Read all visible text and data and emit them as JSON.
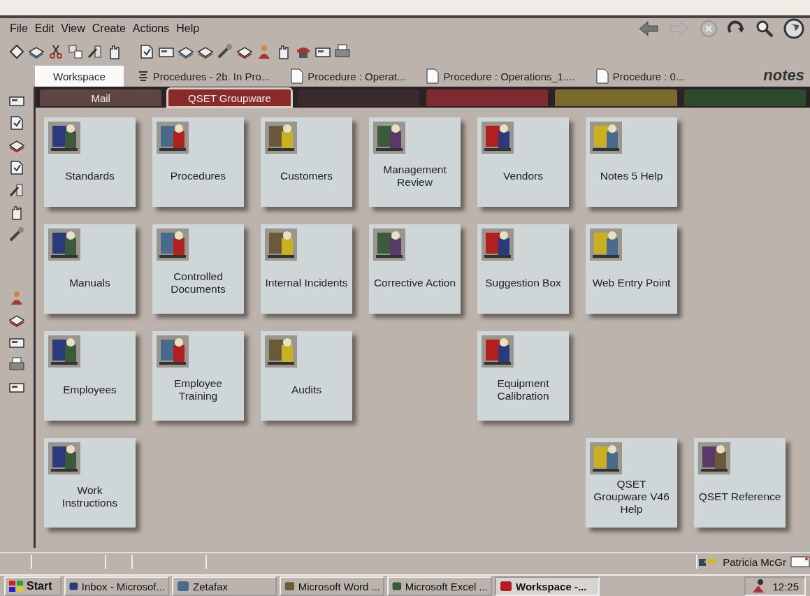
{
  "menu": [
    "File",
    "Edit",
    "View",
    "Create",
    "Actions",
    "Help"
  ],
  "window_tabs": [
    {
      "label": "Workspace",
      "selected": true,
      "kind": "plain"
    },
    {
      "label": "Procedures - 2b. In Pro...",
      "selected": false,
      "kind": "view"
    },
    {
      "label": "Procedure : Operat...",
      "selected": false,
      "kind": "doc"
    },
    {
      "label": "Procedure : Operations_1....",
      "selected": false,
      "kind": "doc"
    },
    {
      "label": "Procedure : 0...",
      "selected": false,
      "kind": "doc"
    }
  ],
  "logo": "notes",
  "workspace_tabs": [
    {
      "label": "Mail",
      "selected": false,
      "color": "#5e4642"
    },
    {
      "label": "QSET Groupware",
      "selected": true,
      "color": "#8a2a2a"
    },
    {
      "selected": false,
      "color": "#3a2a2e"
    },
    {
      "selected": false,
      "color": "#7e2a30"
    },
    {
      "selected": false,
      "color": "#7a6a2e"
    },
    {
      "selected": false,
      "color": "#2e4a2e"
    }
  ],
  "tile_rows": [
    [
      {
        "kind": "tile",
        "label": "Standards"
      },
      {
        "kind": "tile",
        "label": "Procedures"
      },
      {
        "kind": "tile",
        "label": "Customers"
      },
      {
        "kind": "tile",
        "label": "Management Review"
      },
      {
        "kind": "tile",
        "label": "Vendors"
      },
      {
        "kind": "tile",
        "label": "Notes 5 Help"
      },
      {
        "kind": "empty"
      }
    ],
    [
      {
        "kind": "tile",
        "label": "Manuals"
      },
      {
        "kind": "tile",
        "label": "Controlled Documents"
      },
      {
        "kind": "tile",
        "label": "Internal Incidents"
      },
      {
        "kind": "tile",
        "label": "Corrective Action"
      },
      {
        "kind": "tile",
        "label": "Suggestion Box"
      },
      {
        "kind": "tile",
        "label": "Web Entry Point"
      },
      {
        "kind": "empty"
      }
    ],
    [
      {
        "kind": "tile",
        "label": "Employees"
      },
      {
        "kind": "tile",
        "label": "Employee Training"
      },
      {
        "kind": "tile",
        "label": "Audits"
      },
      {
        "kind": "empty"
      },
      {
        "kind": "tile",
        "label": "Equipment Calibration"
      },
      {
        "kind": "empty"
      },
      {
        "kind": "empty"
      }
    ],
    [
      {
        "kind": "tile",
        "label": "Work Instructions"
      },
      {
        "kind": "empty"
      },
      {
        "kind": "empty"
      },
      {
        "kind": "empty"
      },
      {
        "kind": "empty"
      },
      {
        "kind": "tile",
        "label": "QSET Groupware V46 Help"
      },
      {
        "kind": "tile",
        "label": "QSET Reference"
      }
    ]
  ],
  "status_bar": {
    "user": "Patricia McGr"
  },
  "taskbar": {
    "start": "Start",
    "clock": "12:25",
    "items": [
      {
        "label": "Inbox - Microsof...",
        "selected": false
      },
      {
        "label": "Zetafax",
        "selected": false
      },
      {
        "label": "Microsoft Word ...",
        "selected": false
      },
      {
        "label": "Microsoft Excel ...",
        "selected": false
      },
      {
        "label": "Workspace -...",
        "selected": true
      }
    ]
  }
}
